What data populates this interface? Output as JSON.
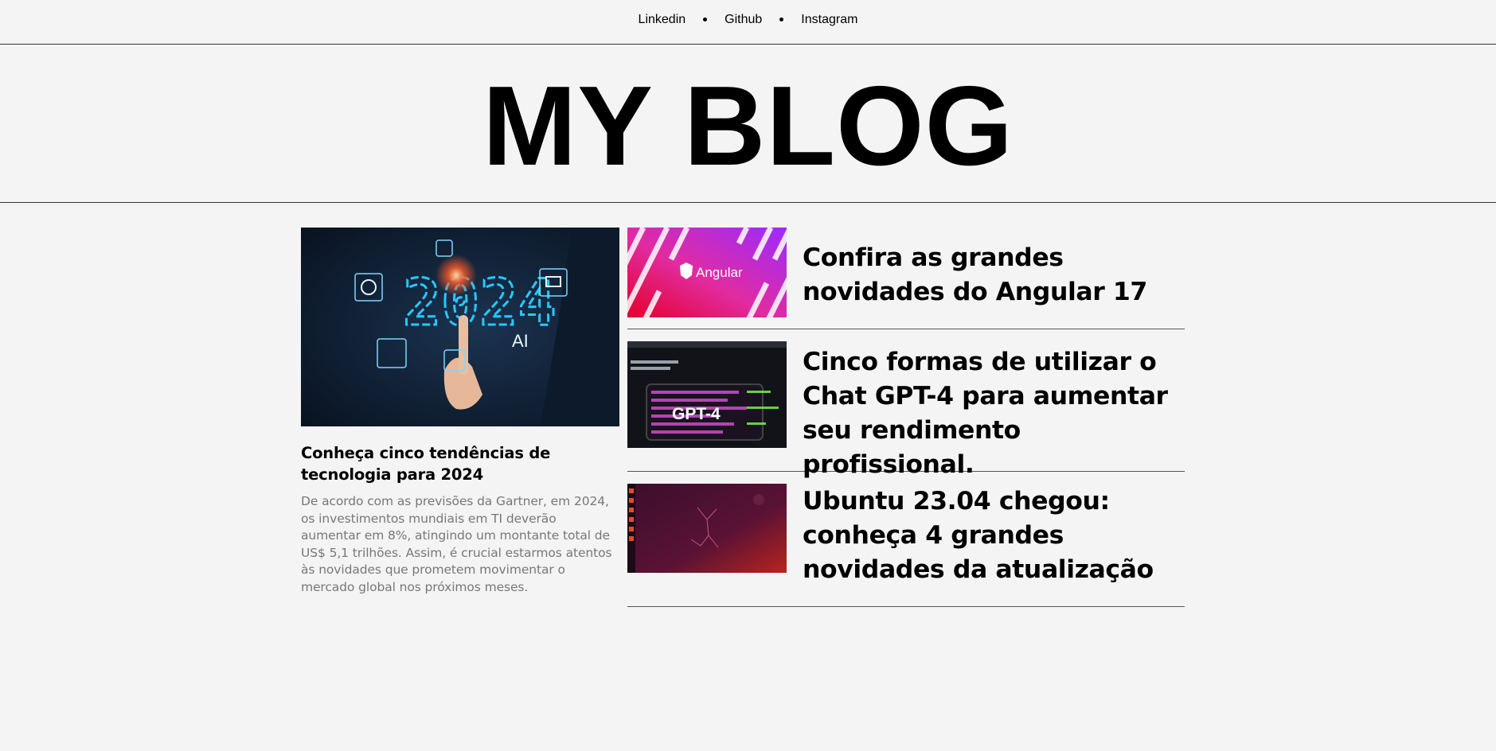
{
  "nav": {
    "links": [
      "Linkedin",
      "Github",
      "Instagram"
    ]
  },
  "header": {
    "title": "MY BLOG"
  },
  "featured": {
    "image_text": "2024",
    "image_badge": "AI",
    "title": "Conheça cinco tendências de tecnologia para 2024",
    "excerpt": "De acordo com as previsões da Gartner, em 2024, os investimentos mundiais em TI deverão aumentar em 8%, atingindo um montante total de US$ 5,1 trilhões. Assim, é crucial estarmos atentos às novidades que prometem movimentar o mercado global nos próximos meses."
  },
  "posts": [
    {
      "title": "Confira as grandes novidades do Angular 17",
      "image_label": "Angular"
    },
    {
      "title": "Cinco formas de utilizar o Chat GPT-4 para aumentar seu rendimento profissional.",
      "image_label": "GPT-4"
    },
    {
      "title": "Ubuntu 23.04 chegou: conheça 4 grandes novidades da atualização"
    }
  ],
  "colors": {
    "background": "#f4f4f4",
    "text": "#000000",
    "excerpt": "#777777",
    "divider": "#333333"
  }
}
